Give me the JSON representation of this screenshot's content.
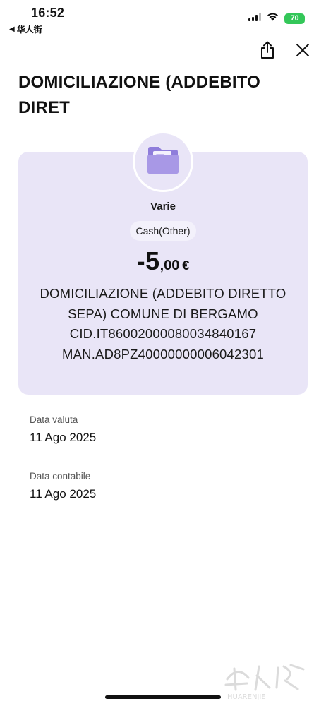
{
  "status_bar": {
    "time": "16:52",
    "back_app": "华人街",
    "battery": "70"
  },
  "header": {
    "share_icon": "share-icon",
    "close_icon": "close-icon",
    "title_line1": "DOMICILIAZIONE (ADDEBITO",
    "title_line2": "DIRET"
  },
  "transaction": {
    "category_icon": "folder-icon",
    "category": "Varie",
    "type_pill": "Cash(Other)",
    "amount_main": "-5",
    "amount_decimal": ",00",
    "currency": "€",
    "description_lines": [
      "DOMICILIAZIONE (ADDEBITO DIRETTO",
      "SEPA) COMUNE DI BERGAMO",
      "CID.IT86002000080034840167",
      "MAN.AD8PZ40000000006042301"
    ]
  },
  "details": [
    {
      "label": "Data valuta",
      "value": "11 Ago 2025"
    },
    {
      "label": "Data contabile",
      "value": "11 Ago 2025"
    }
  ],
  "watermark": {
    "brand": "HUARENJIE"
  },
  "colors": {
    "card_bg": "#e9e5f7",
    "folder": "#a898e6",
    "folder_dark": "#8f7ddb",
    "battery": "#34c759"
  }
}
